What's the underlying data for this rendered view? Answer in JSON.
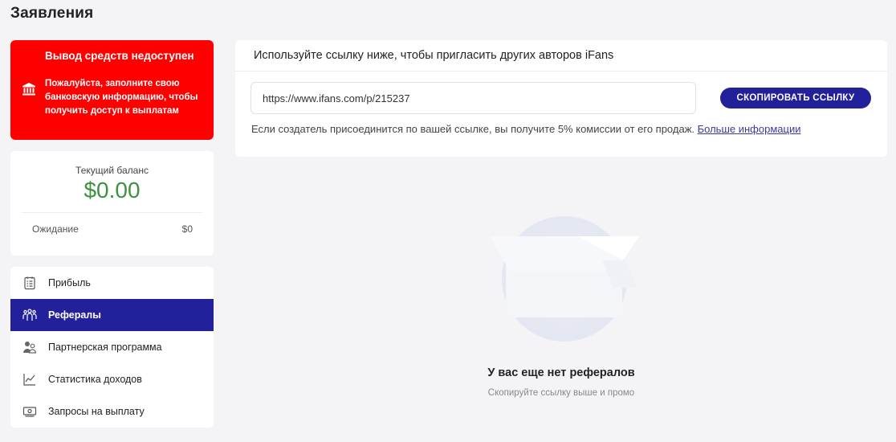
{
  "page": {
    "title": "Заявления"
  },
  "alert": {
    "title": "Вывод средств недоступен",
    "text": "Пожалуйста, заполните свою банковскую информацию, чтобы получить доступ к выплатам",
    "icon": "bank-icon",
    "color": "#ff0000"
  },
  "balance": {
    "label": "Текущий баланс",
    "value": "$0.00",
    "pending_label": "Ожидание",
    "pending_value": "$0",
    "value_color": "#3f9142"
  },
  "nav": {
    "active_color": "#23209c",
    "items": [
      {
        "label": "Прибыль",
        "icon": "earnings-icon"
      },
      {
        "label": "Рефералы",
        "icon": "referrals-icon",
        "active": true
      },
      {
        "label": "Партнерская программа",
        "icon": "partner-icon"
      },
      {
        "label": "Статистика доходов",
        "icon": "stats-icon"
      },
      {
        "label": "Запросы на выплату",
        "icon": "payout-icon"
      }
    ]
  },
  "referral": {
    "title": "Используйте ссылку ниже, чтобы пригласить других авторов  iFans",
    "link": "https://www.ifans.com/p/215237",
    "copy_label": "СКОПИРОВАТЬ ССЫЛКУ",
    "note": "Если создатель присоединится по вашей ссылке, вы получите 5% комиссии от его продаж. ",
    "more_link": "Больше информации"
  },
  "empty": {
    "title": "У вас еще нет рефералов",
    "subtitle": "Скопируйте ссылку выше и промо"
  }
}
